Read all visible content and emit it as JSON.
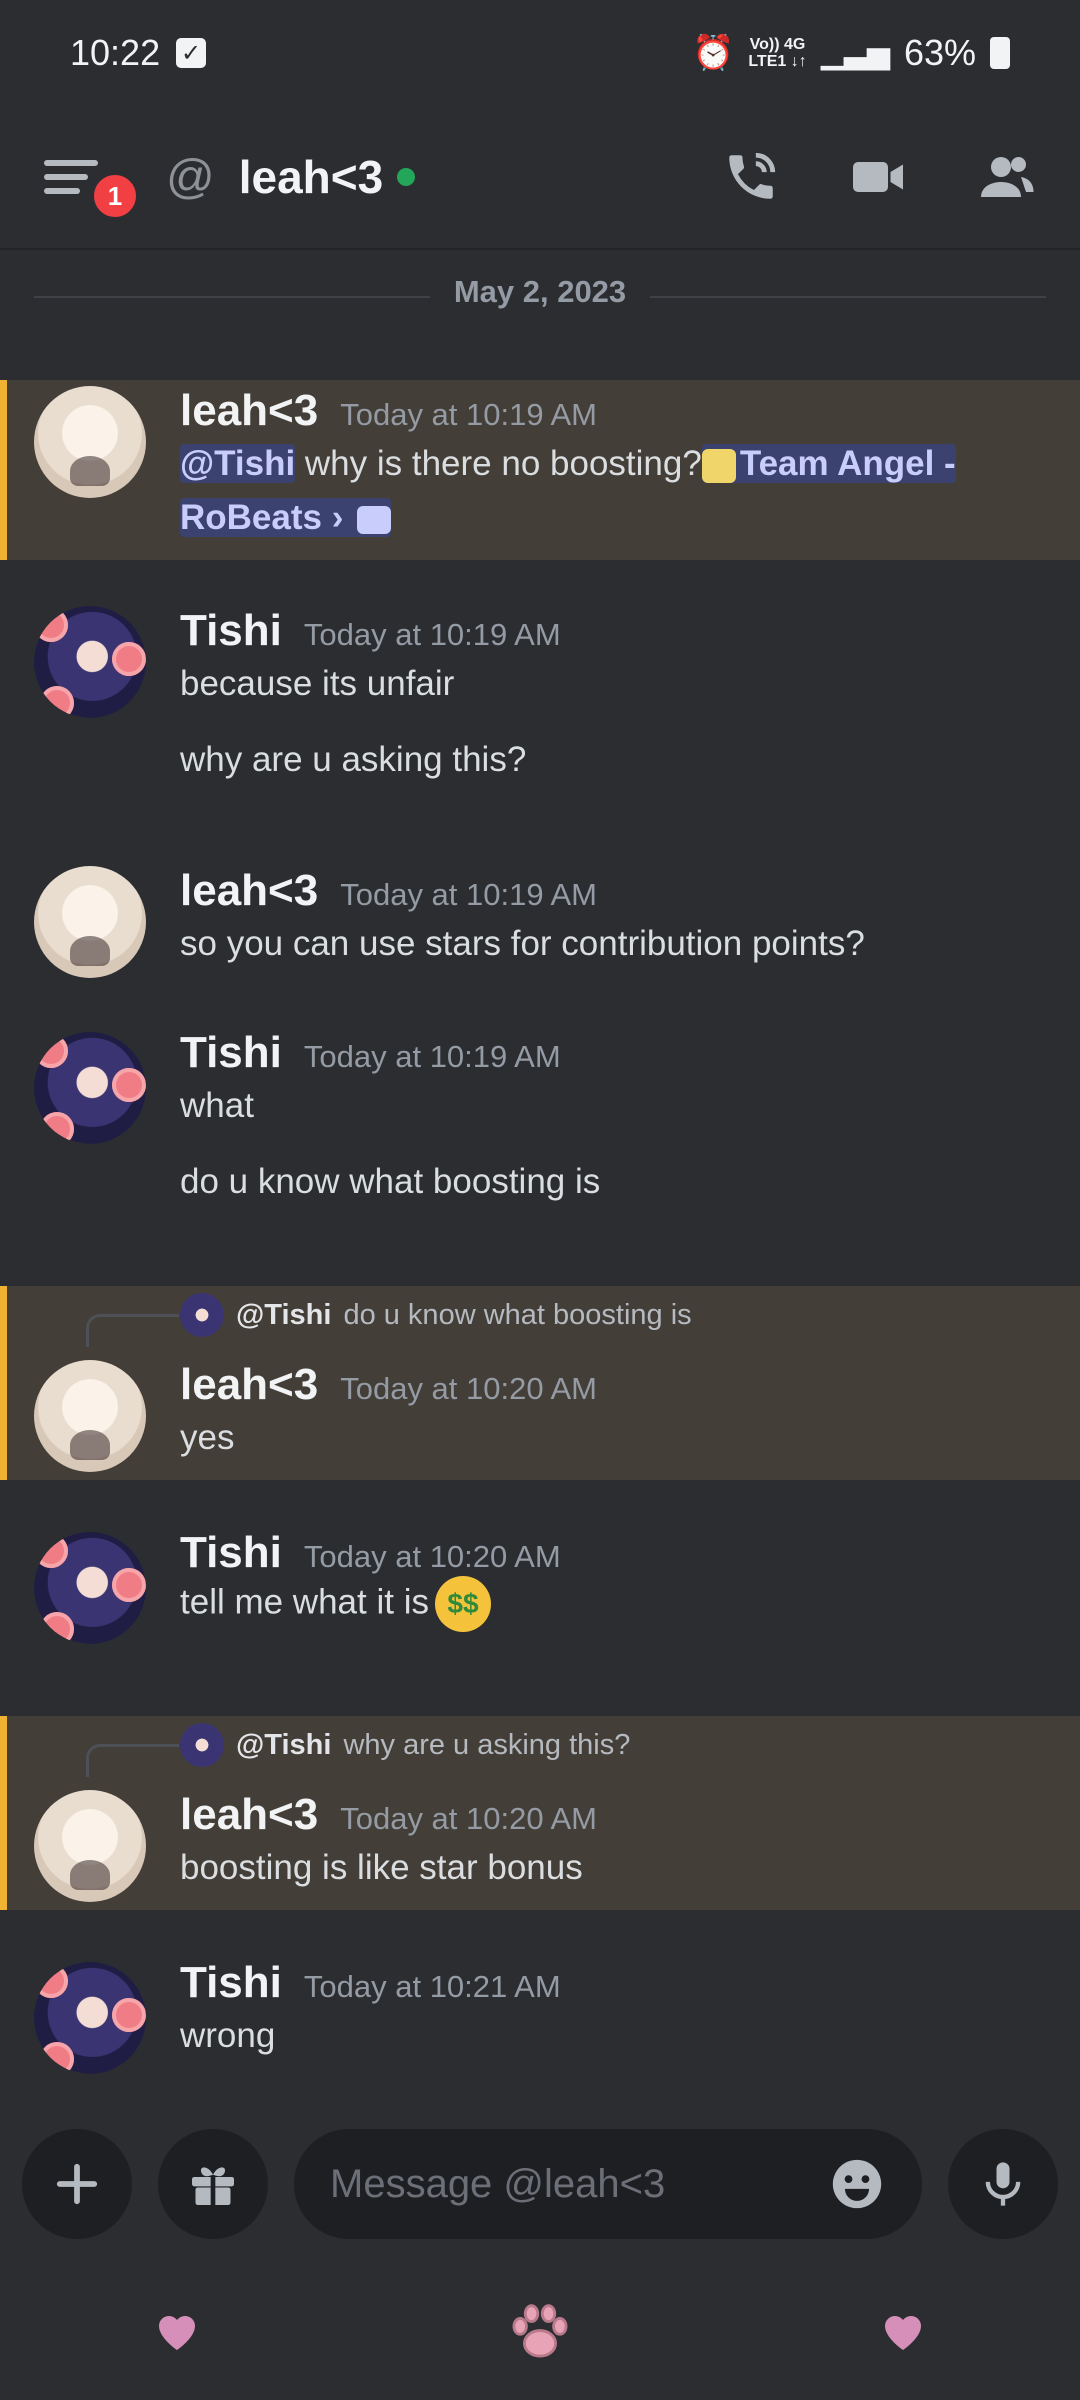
{
  "status_bar": {
    "time": "10:22",
    "network_top": "Vo)) 4G",
    "network_bottom": "LTE1 ↓↑",
    "battery": "63%"
  },
  "header": {
    "badge_count": "1",
    "at_symbol": "@",
    "title": "leah<3"
  },
  "date_divider": "May 2, 2023",
  "messages": [
    {
      "author": "leah<3",
      "time": "Today at 10:19 AM",
      "mention": "@Tishi",
      "text": " why is there no boosting?",
      "channel_name": "Team Angel -",
      "channel_name2": "RoBeats",
      "arrow": "›"
    },
    {
      "author": "Tishi",
      "time": "Today at 10:19 AM",
      "line1": "because its unfair",
      "line2": "why are u asking this?"
    },
    {
      "author": "leah<3",
      "time": "Today at 10:19 AM",
      "line1": "so you can use stars for contribution points?"
    },
    {
      "author": "Tishi",
      "time": "Today at 10:19 AM",
      "line1": "what",
      "line2": "do u know what boosting is"
    },
    {
      "reply_name": "@Tishi",
      "reply_text": "do u know what boosting is",
      "author": "leah<3",
      "time": "Today at 10:20 AM",
      "line1": "yes"
    },
    {
      "author": "Tishi",
      "time": "Today at 10:20 AM",
      "line1": "tell me what it is",
      "emoji": "$$"
    },
    {
      "reply_name": "@Tishi",
      "reply_text": "why are u asking this?",
      "author": "leah<3",
      "time": "Today at 10:20 AM",
      "line1": "boosting is like  star bonus"
    },
    {
      "author": "Tishi",
      "time": "Today at 10:21 AM",
      "line1": "wrong"
    }
  ],
  "composer": {
    "placeholder": "Message @leah<3"
  },
  "colors": {
    "background": "#2b2d31",
    "mention_bg": "#433e37",
    "mention_bar": "#f0b232",
    "online": "#23a55a",
    "badge": "#f23f43"
  }
}
